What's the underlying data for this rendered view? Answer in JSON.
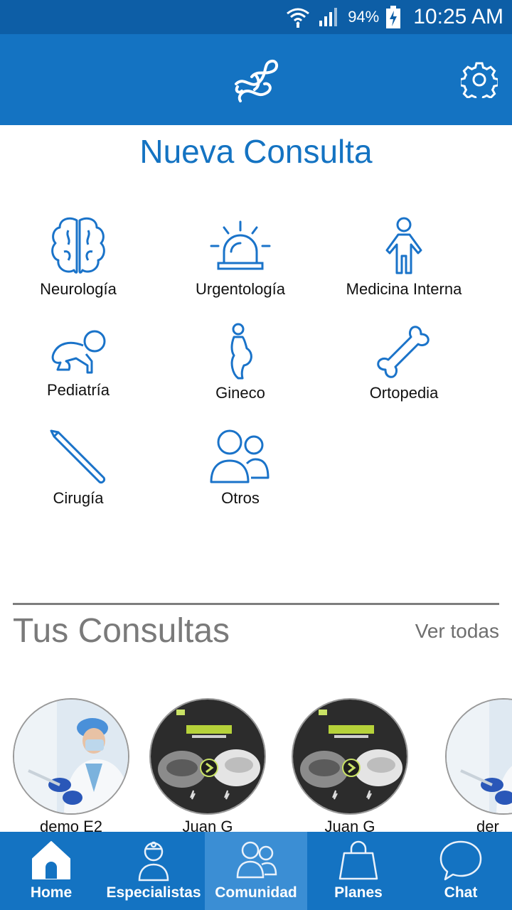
{
  "status_bar": {
    "battery": "94%",
    "time": "10:25 AM"
  },
  "header": {
    "logo_icon": "dna-logo-icon",
    "settings_icon": "gear-icon"
  },
  "page_title": "Nueva Consulta",
  "categories": [
    {
      "label": "Neurología",
      "icon": "brain-icon"
    },
    {
      "label": "Urgentología",
      "icon": "siren-icon"
    },
    {
      "label": "Medicina Interna",
      "icon": "person-icon"
    },
    {
      "label": "Pediatría",
      "icon": "crawling-baby-icon"
    },
    {
      "label": "Gineco",
      "icon": "pregnant-icon"
    },
    {
      "label": "Ortopedia",
      "icon": "bone-icon"
    },
    {
      "label": "Cirugía",
      "icon": "scalpel-icon"
    },
    {
      "label": "Otros",
      "icon": "group-icon"
    }
  ],
  "consultas": {
    "title": "Tus Consultas",
    "see_all": "Ver todas",
    "items": [
      {
        "name": "demo E2"
      },
      {
        "name": "Juan G"
      },
      {
        "name": "Juan G"
      },
      {
        "name": "der"
      }
    ]
  },
  "bottom_nav": {
    "items": [
      {
        "label": "Home",
        "icon": "home-icon"
      },
      {
        "label": "Especialistas",
        "icon": "doctor-icon"
      },
      {
        "label": "Comunidad",
        "icon": "community-icon"
      },
      {
        "label": "Planes",
        "icon": "shopping-bag-icon"
      },
      {
        "label": "Chat",
        "icon": "chat-bubble-icon"
      }
    ],
    "active": "Comunidad"
  },
  "colors": {
    "primary": "#1473c2",
    "status_bar": "#0d5ea6",
    "icon_blue": "#1a73c9"
  }
}
